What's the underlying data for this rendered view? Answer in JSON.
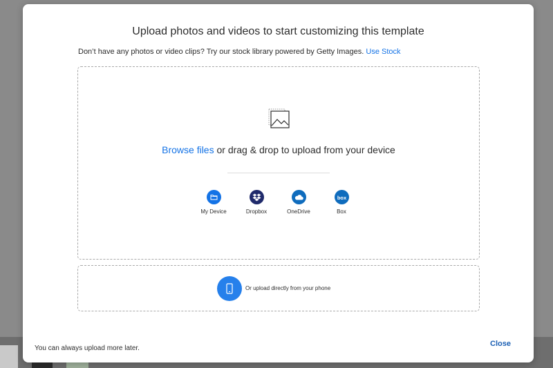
{
  "modal": {
    "title": "Upload photos and videos to start customizing this template",
    "stock_text": "Don’t have any photos or video clips? Try our stock library powered by Getty Images.",
    "stock_link": "Use Stock",
    "browse_link": "Browse files",
    "browse_rest": " or drag & drop to upload from your device",
    "sources": [
      {
        "label": "My Device",
        "icon": "folder-icon",
        "color": "#1473e6"
      },
      {
        "label": "Dropbox",
        "icon": "dropbox-icon",
        "color": "#1f2a6b"
      },
      {
        "label": "OneDrive",
        "icon": "cloud-icon",
        "color": "#0f6cbd"
      },
      {
        "label": "Box",
        "icon": "box-icon",
        "color": "#0f6cbd"
      }
    ],
    "phone_text": "Or upload directly from your phone",
    "footer_note": "You can always upload more later.",
    "close_label": "Close"
  },
  "colors": {
    "accent": "#1473e6",
    "phone_button": "#2680eb",
    "overlay": "#8a8a8a"
  }
}
